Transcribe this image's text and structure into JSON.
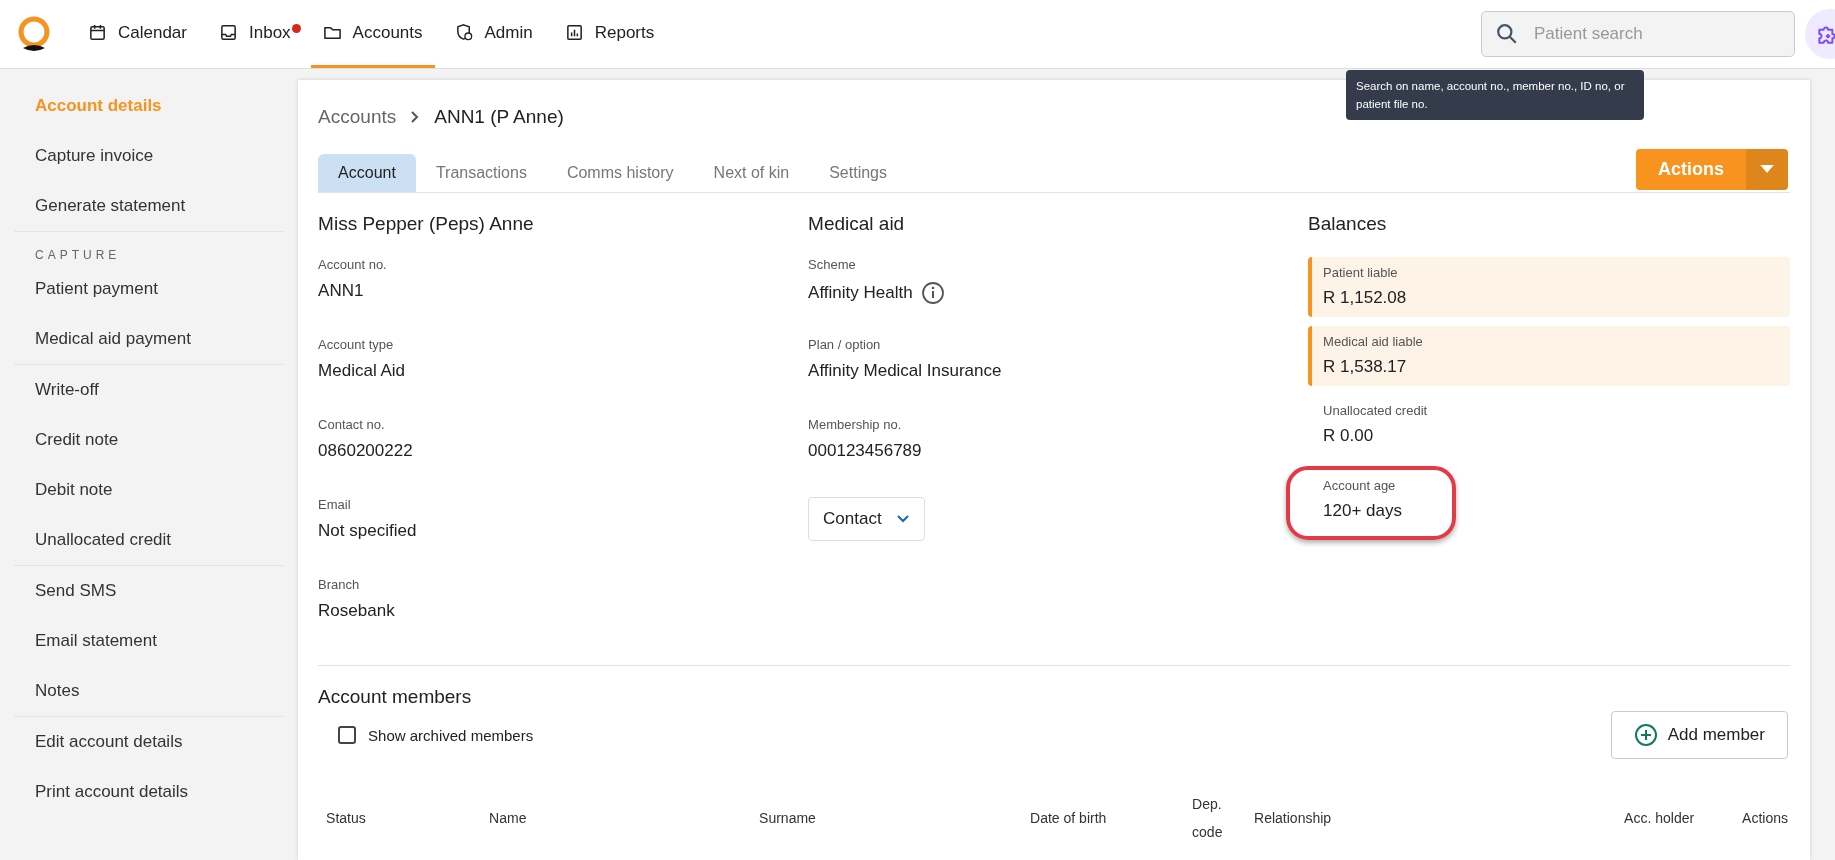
{
  "nav": {
    "items": [
      {
        "label": "Calendar",
        "selected": false,
        "badge": false
      },
      {
        "label": "Inbox",
        "selected": false,
        "badge": true
      },
      {
        "label": "Accounts",
        "selected": true,
        "badge": false
      },
      {
        "label": "Admin",
        "selected": false,
        "badge": false
      },
      {
        "label": "Reports",
        "selected": false,
        "badge": false
      }
    ],
    "search": {
      "placeholder": "Patient search",
      "tooltip": "Search on name, account no., member no., ID no, or patient file no."
    }
  },
  "sidebar": {
    "groups": [
      {
        "items": [
          {
            "label": "Account details",
            "selected": true
          },
          {
            "label": "Capture invoice",
            "selected": false
          },
          {
            "label": "Generate statement",
            "selected": false
          }
        ]
      },
      {
        "heading": "CAPTURE",
        "items": [
          {
            "label": "Patient payment",
            "selected": false
          },
          {
            "label": "Medical aid payment",
            "selected": false
          }
        ]
      },
      {
        "items": [
          {
            "label": "Write-off",
            "selected": false
          },
          {
            "label": "Credit note",
            "selected": false
          },
          {
            "label": "Debit note",
            "selected": false
          },
          {
            "label": "Unallocated credit",
            "selected": false
          }
        ]
      },
      {
        "items": [
          {
            "label": "Send SMS",
            "selected": false
          },
          {
            "label": "Email statement",
            "selected": false
          },
          {
            "label": "Notes",
            "selected": false
          }
        ]
      },
      {
        "items": [
          {
            "label": "Edit account details",
            "selected": false
          },
          {
            "label": "Print account details",
            "selected": false
          }
        ]
      }
    ]
  },
  "breadcrumb": [
    "Accounts",
    "ANN1 (P Anne)"
  ],
  "tabs": [
    {
      "label": "Account",
      "selected": true
    },
    {
      "label": "Transactions",
      "selected": false
    },
    {
      "label": "Comms history",
      "selected": false
    },
    {
      "label": "Next of kin",
      "selected": false
    },
    {
      "label": "Settings",
      "selected": false
    }
  ],
  "actions_button": "Actions",
  "patient": {
    "title": "Miss Pepper (Peps) Anne",
    "fields": [
      {
        "label": "Account no.",
        "value": "ANN1"
      },
      {
        "label": "Account type",
        "value": "Medical Aid"
      },
      {
        "label": "Contact no.",
        "value": "0860200222"
      },
      {
        "label": "Email",
        "value": "Not specified"
      },
      {
        "label": "Branch",
        "value": "Rosebank"
      }
    ]
  },
  "medical_aid": {
    "title": "Medical aid",
    "fields": [
      {
        "label": "Scheme",
        "value": "Affinity Health",
        "info": true
      },
      {
        "label": "Plan / option",
        "value": "Affinity Medical Insurance",
        "info": false
      },
      {
        "label": "Membership no.",
        "value": "000123456789",
        "info": false
      }
    ],
    "contact_button": "Contact"
  },
  "balances": {
    "title": "Balances",
    "items": [
      {
        "kind": "liable",
        "label": "Patient liable",
        "value": "R 1,152.08",
        "highlighted": false
      },
      {
        "kind": "liable",
        "label": "Medical aid liable",
        "value": "R 1,538.17",
        "highlighted": false
      },
      {
        "kind": "plain",
        "label": "Unallocated credit",
        "value": "R 0.00",
        "highlighted": false
      },
      {
        "kind": "plain",
        "label": "Account age",
        "value": "120+ days",
        "highlighted": true
      }
    ]
  },
  "members": {
    "title": "Account members",
    "show_archived": {
      "label": "Show archived members",
      "checked": false
    },
    "add_button": "Add member",
    "columns": [
      "Status",
      "Name",
      "Surname",
      "Date of birth",
      "Dep. code",
      "Relationship",
      "Acc. holder",
      "Actions"
    ]
  }
}
